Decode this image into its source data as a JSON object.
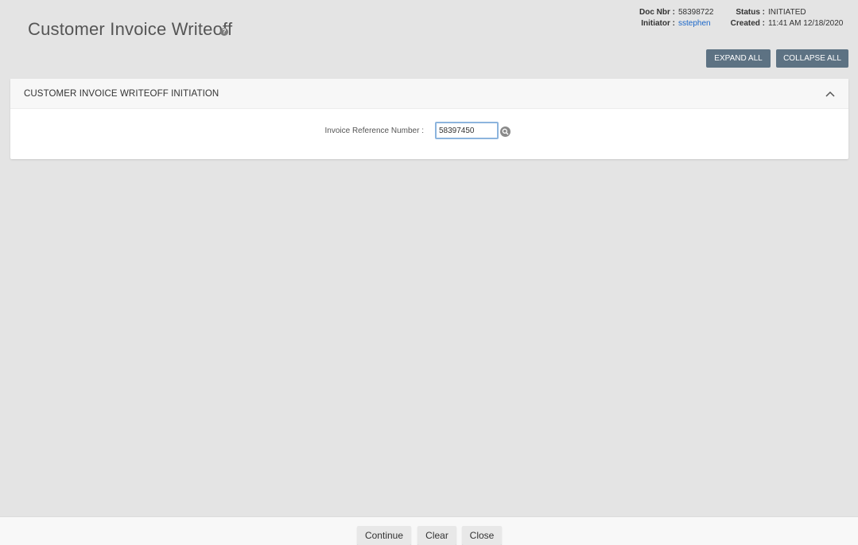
{
  "page": {
    "title": "Customer Invoice Writeoff",
    "help_icon": "?"
  },
  "meta": {
    "doc_nbr_label": "Doc Nbr :",
    "doc_nbr_value": "58398722",
    "initiator_label": "Initiator :",
    "initiator_value": "sstephen",
    "status_label": "Status :",
    "status_value": "INITIATED",
    "created_label": "Created :",
    "created_value": "11:41 AM 12/18/2020"
  },
  "toolbar": {
    "expand_all": "EXPAND ALL",
    "collapse_all": "COLLAPSE ALL"
  },
  "section": {
    "title": "CUSTOMER INVOICE WRITEOFF INITIATION",
    "collapse_icon": "chevron-up-icon",
    "invoice_ref_label": "Invoice Reference Number :",
    "invoice_ref_value": "58397450",
    "search_icon": "search-icon"
  },
  "footer": {
    "continue": "Continue",
    "clear": "Clear",
    "close": "Close"
  },
  "colors": {
    "dark_button": "#5d7283",
    "link": "#1a66c9",
    "input_border": "#8cb4dd",
    "background": "#e4e4e4"
  }
}
